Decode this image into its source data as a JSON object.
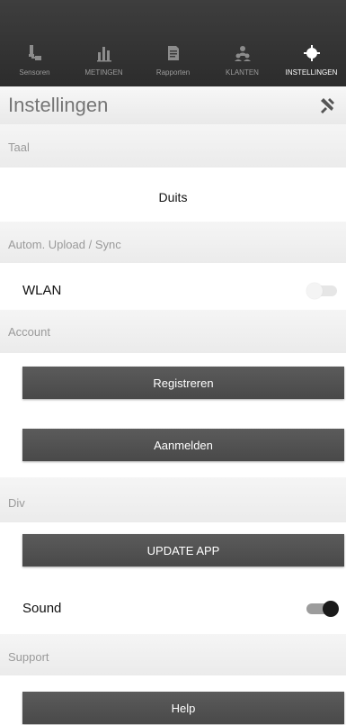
{
  "nav": {
    "items": [
      {
        "label": "Sensoren",
        "icon": "sensor-icon"
      },
      {
        "label": "METINGEN",
        "icon": "bar-chart-icon"
      },
      {
        "label": "Rapporten",
        "icon": "report-icon"
      },
      {
        "label": "KLANTEN",
        "icon": "clients-icon"
      },
      {
        "label": "INSTELLINGEN",
        "icon": "gear-icon"
      }
    ],
    "active_index": 4
  },
  "header": {
    "title": "Instellingen",
    "tools_icon": "tools-icon"
  },
  "sections": {
    "language": {
      "title": "Taal",
      "value": "Duits"
    },
    "sync": {
      "title": "Autom. Upload / Sync",
      "wlan_label": "WLAN",
      "wlan_on": false
    },
    "account": {
      "title": "Account",
      "register_label": "Registreren",
      "login_label": "Aanmelden"
    },
    "misc": {
      "title": "Div",
      "update_label": "UPDATE APP",
      "sound_label": "Sound",
      "sound_on": true
    },
    "support": {
      "title": "Support",
      "help_label": "Help"
    }
  },
  "colors": {
    "nav_bg": "#333333",
    "button_bg": "#525252",
    "section_text": "#9a9a9a"
  }
}
